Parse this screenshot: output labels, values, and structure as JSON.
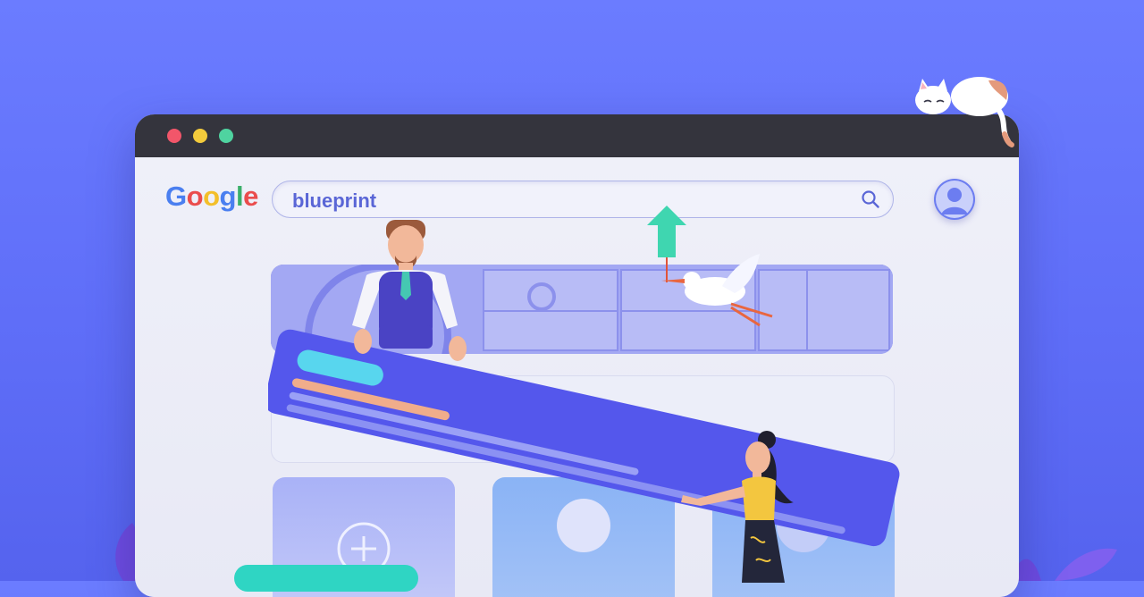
{
  "window": {
    "controls": [
      "close",
      "minimize",
      "maximize"
    ]
  },
  "header": {
    "logo_text": "Google",
    "logo_letters": [
      "G",
      "o",
      "o",
      "g",
      "l",
      "e"
    ],
    "search_value": "blueprint",
    "search_icon": "search-icon",
    "avatar_icon": "user-avatar-icon"
  },
  "colors": {
    "background": "#6b7cff",
    "titlebar": "#34343d",
    "accent": "#5a5cf0",
    "cyan": "#2fd5c3",
    "arrow": "#3fd6b0"
  },
  "illustration": {
    "elements": [
      "man-figure",
      "woman-figure",
      "stork-bird",
      "upload-arrow",
      "cat-on-window"
    ]
  }
}
